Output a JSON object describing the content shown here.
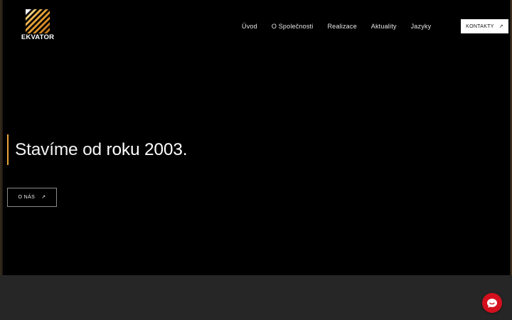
{
  "brand": {
    "name": "EKVATOR",
    "logo_icon": "striped-square-logo-icon",
    "accent_color": "#e8a33a"
  },
  "nav": {
    "items": [
      {
        "label": "Úvod"
      },
      {
        "label": "O Společnosti"
      },
      {
        "label": "Realizace"
      },
      {
        "label": "Aktuality"
      },
      {
        "label": "Jazyky"
      }
    ],
    "contact_label": "KONTAKTY",
    "contact_icon": "arrow-up-right-icon"
  },
  "hero": {
    "headline_part1": "Stavíme od ",
    "headline_part2": "roku 2003.",
    "about_label": "O NÁS",
    "about_icon": "arrow-up-right-icon"
  },
  "chat": {
    "icon": "chat-bubble-icon",
    "color": "#d4101e"
  }
}
